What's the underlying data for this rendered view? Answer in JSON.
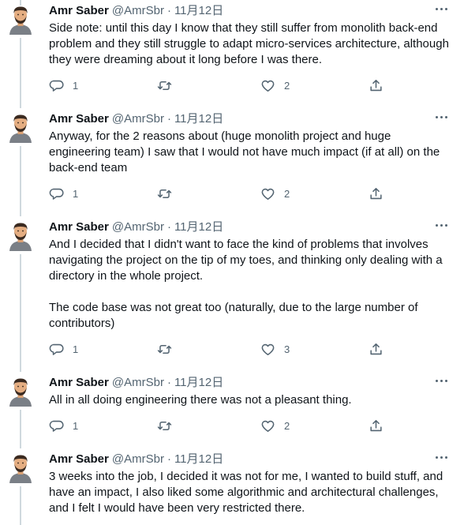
{
  "author": {
    "name": "Amr Saber",
    "handle": "@AmrSbr",
    "separator": "·"
  },
  "icons": {
    "reply": "reply-icon",
    "retweet": "retweet-icon",
    "like": "like-icon",
    "share": "share-icon",
    "more": "more-icon"
  },
  "colors": {
    "text": "#0f1419",
    "secondary": "#536471",
    "thread_line": "#cfd9de"
  },
  "tweets": [
    {
      "date": "11月12日",
      "paragraphs": [
        "Side note: until this day I know that they still suffer from monolith back-end problem and they still struggle to adapt micro-services architecture, although they were dreaming about it long before I was there."
      ],
      "replies": "1",
      "retweets": "",
      "likes": "2"
    },
    {
      "date": "11月12日",
      "paragraphs": [
        "Anyway, for the 2 reasons about (huge monolith project and huge engineering team) I saw that I would not have much impact (if at all) on the back-end team"
      ],
      "replies": "1",
      "retweets": "",
      "likes": "2"
    },
    {
      "date": "11月12日",
      "paragraphs": [
        "And I decided that I didn't want to face the kind of problems that involves navigating the project on the tip of my toes, and thinking only dealing with a directory in the whole project.",
        "The code base was not great too (naturally, due to the large number of contributors)"
      ],
      "replies": "1",
      "retweets": "",
      "likes": "3"
    },
    {
      "date": "11月12日",
      "paragraphs": [
        "All in all doing engineering there was not a pleasant thing."
      ],
      "replies": "1",
      "retweets": "",
      "likes": "2"
    },
    {
      "date": "11月12日",
      "paragraphs": [
        "3 weeks into the job, I decided it was not for me, I wanted to build stuff, and have an impact, I also liked some algorithmic and architectural challenges, and I felt I would have been very restricted there."
      ]
    }
  ]
}
